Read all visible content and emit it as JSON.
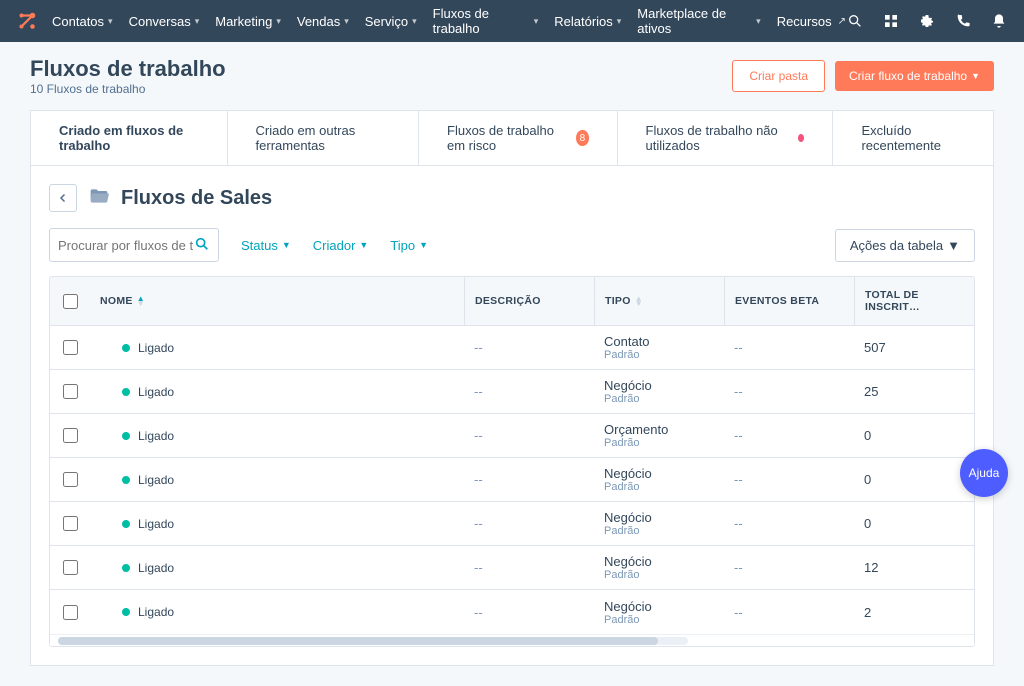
{
  "nav": {
    "items": [
      {
        "label": "Contatos"
      },
      {
        "label": "Conversas"
      },
      {
        "label": "Marketing"
      },
      {
        "label": "Vendas"
      },
      {
        "label": "Serviço"
      },
      {
        "label": "Fluxos de trabalho"
      },
      {
        "label": "Relatórios"
      },
      {
        "label": "Marketplace de ativos"
      },
      {
        "label": "Recursos",
        "external": true
      }
    ]
  },
  "header": {
    "title": "Fluxos de trabalho",
    "subtitle": "10 Fluxos de trabalho",
    "create_folder": "Criar pasta",
    "create_workflow": "Criar fluxo de trabalho"
  },
  "tabs": [
    {
      "label": "Criado em fluxos de trabalho",
      "active": true
    },
    {
      "label": "Criado em outras ferramentas"
    },
    {
      "label": "Fluxos de trabalho em risco",
      "badge": "8"
    },
    {
      "label": "Fluxos de trabalho não utilizados",
      "warn": true
    },
    {
      "label": "Excluído recentemente"
    }
  ],
  "breadcrumb": {
    "folder_title": "Fluxos de Sales"
  },
  "controls": {
    "search_placeholder": "Procurar por fluxos de trabalho",
    "filters": [
      {
        "label": "Status"
      },
      {
        "label": "Criador"
      },
      {
        "label": "Tipo"
      }
    ],
    "table_actions": "Ações da tabela"
  },
  "table": {
    "headers": {
      "name": "NOME",
      "desc": "DESCRIÇÃO",
      "type": "TIPO",
      "events": "EVENTOS BETA",
      "total": "TOTAL DE INSCRIT…"
    },
    "rows": [
      {
        "status": "Ligado",
        "desc": "--",
        "type_main": "Contato",
        "type_sub": "Padrão",
        "events": "--",
        "total": "507"
      },
      {
        "status": "Ligado",
        "desc": "--",
        "type_main": "Negócio",
        "type_sub": "Padrão",
        "events": "--",
        "total": "25"
      },
      {
        "status": "Ligado",
        "desc": "--",
        "type_main": "Orçamento",
        "type_sub": "Padrão",
        "events": "--",
        "total": "0"
      },
      {
        "status": "Ligado",
        "desc": "--",
        "type_main": "Negócio",
        "type_sub": "Padrão",
        "events": "--",
        "total": "0"
      },
      {
        "status": "Ligado",
        "desc": "--",
        "type_main": "Negócio",
        "type_sub": "Padrão",
        "events": "--",
        "total": "0"
      },
      {
        "status": "Ligado",
        "desc": "--",
        "type_main": "Negócio",
        "type_sub": "Padrão",
        "events": "--",
        "total": "12"
      },
      {
        "status": "Ligado",
        "desc": "--",
        "type_main": "Negócio",
        "type_sub": "Padrão",
        "events": "--",
        "total": "2"
      }
    ]
  },
  "help_fab": "Ajuda"
}
